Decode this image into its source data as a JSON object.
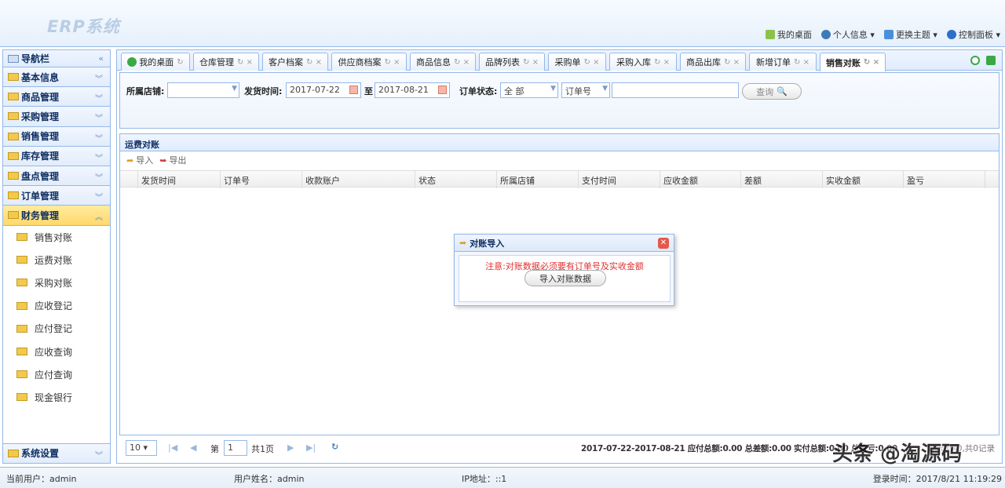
{
  "header": {
    "logo": "ERP系统",
    "nav": [
      "我的桌面",
      "个人信息 ▾",
      "更换主题 ▾",
      "控制面板 ▾"
    ]
  },
  "sidebar": {
    "title": "导航栏",
    "groups": [
      "基本信息",
      "商品管理",
      "采购管理",
      "销售管理",
      "库存管理",
      "盘点管理",
      "订单管理",
      "财务管理"
    ],
    "sub_items": [
      "销售对账",
      "运费对账",
      "采购对账",
      "应收登记",
      "应付登记",
      "应收查询",
      "应付查询",
      "现金银行"
    ],
    "bottom": "系统设置"
  },
  "tabs": [
    "我的桌面",
    "仓库管理",
    "客户档案",
    "供应商档案",
    "商品信息",
    "品牌列表",
    "采购单",
    "采购入库",
    "商品出库",
    "新增订单",
    "销售对账"
  ],
  "filter": {
    "store_label": "所属店铺:",
    "ship_label": "发货时间:",
    "date_from": "2017-07-22",
    "to_label": "至",
    "date_to": "2017-08-21",
    "status_label": "订单状态:",
    "status_value": "全 部",
    "field_value": "订单号",
    "query_button": "查询"
  },
  "panel": {
    "title": "运费对账",
    "import": "导入",
    "export": "导出",
    "columns": [
      "发货时间",
      "订单号",
      "收款账户",
      "状态",
      "所属店铺",
      "支付时间",
      "应收金额",
      "差额",
      "实收金额",
      "盈亏"
    ]
  },
  "pager": {
    "page_size": "10 ▾",
    "page_prefix": "第",
    "page_value": "1",
    "page_total": "共1页",
    "summary": "2017-07-22-2017-08-21 应付总额:0.00 总差额:0.00 实付总额:0.00 总盈亏:0.00",
    "records": "显示0到0,共0记录"
  },
  "status": {
    "user": "当前用户：admin",
    "name": "用户姓名：admin",
    "ip": "IP地址：::1",
    "login": "登录时间：2017/8/21 11:19:29"
  },
  "dialog": {
    "title": "对账导入",
    "note": "注意:对账数据必须要有订单号及实收金额",
    "button": "导入对账数据"
  },
  "watermark": "头条 @淘源码"
}
